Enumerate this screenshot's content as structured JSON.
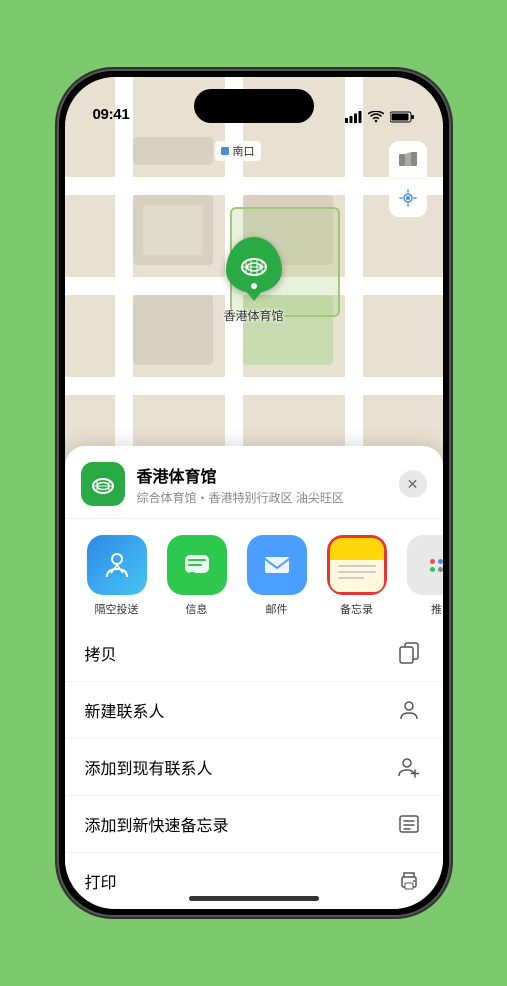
{
  "status_bar": {
    "time": "09:41",
    "location_arrow": "▶"
  },
  "map": {
    "label": "南口",
    "marker_name": "香港体育馆"
  },
  "map_controls": {
    "map_icon": "🗺",
    "location_icon": "➤"
  },
  "sheet": {
    "title": "香港体育馆",
    "subtitle": "综合体育馆・香港特别行政区 油尖旺区",
    "close_label": "✕"
  },
  "share_items": [
    {
      "id": "airdrop",
      "label": "隔空投送",
      "type": "airdrop"
    },
    {
      "id": "message",
      "label": "信息",
      "type": "message"
    },
    {
      "id": "mail",
      "label": "邮件",
      "type": "mail"
    },
    {
      "id": "notes",
      "label": "备忘录",
      "type": "notes",
      "selected": true
    },
    {
      "id": "more",
      "label": "推",
      "type": "more"
    }
  ],
  "action_items": [
    {
      "id": "copy",
      "label": "拷贝",
      "icon": "copy"
    },
    {
      "id": "new-contact",
      "label": "新建联系人",
      "icon": "contact"
    },
    {
      "id": "add-existing",
      "label": "添加到现有联系人",
      "icon": "add-contact"
    },
    {
      "id": "quick-note",
      "label": "添加到新快速备忘录",
      "icon": "quick-note"
    },
    {
      "id": "print",
      "label": "打印",
      "icon": "print"
    }
  ]
}
